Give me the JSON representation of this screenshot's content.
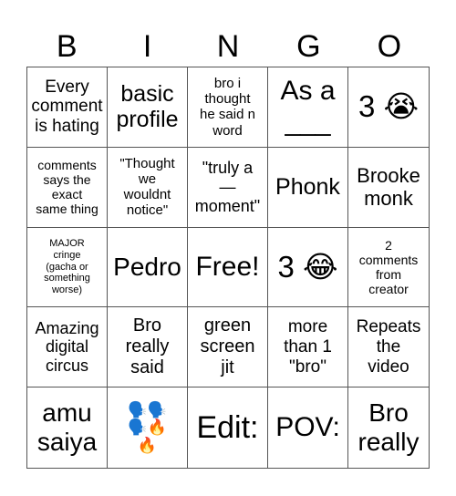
{
  "header": [
    "B",
    "I",
    "N",
    "G",
    "O"
  ],
  "cells": [
    {
      "text": "Every\ncomment\nis hating",
      "name": "every-comment-is-hating"
    },
    {
      "text": "basic\nprofile",
      "name": "basic-profile"
    },
    {
      "text": "bro i\nthought\nhe said n\nword",
      "name": "bro-i-thought-he-said-n-word"
    },
    {
      "text": "As a\n___",
      "name": "as-a-blank"
    },
    {
      "text": "3 😭",
      "name": "three-crying-emoji"
    },
    {
      "text": "comments\nsays the\nexact\nsame thing",
      "name": "comments-say-the-exact-same-thing"
    },
    {
      "text": "\"Thought\nwe\nwouldnt\nnotice\"",
      "name": "thought-we-wouldnt-notice"
    },
    {
      "text": "\"truly a\n—\nmoment\"",
      "name": "truly-a-moment"
    },
    {
      "text": "Phonk",
      "name": "phonk"
    },
    {
      "text": "Brooke\nmonk",
      "name": "brooke-monk"
    },
    {
      "text": "MAJOR\ncringe\n(gacha or\nsomething\nworse)",
      "name": "major-cringe"
    },
    {
      "text": "Pedro",
      "name": "pedro"
    },
    {
      "text": "Free!",
      "name": "free-space"
    },
    {
      "text": "3 😂",
      "name": "three-laughing-emoji"
    },
    {
      "text": "2\ncomments\nfrom\ncreator",
      "name": "two-comments-from-creator"
    },
    {
      "text": "Amazing\ndigital\ncircus",
      "name": "amazing-digital-circus"
    },
    {
      "text": "Bro\nreally\nsaid",
      "name": "bro-really-said"
    },
    {
      "text": "green\nscreen\njit",
      "name": "green-screen-jit"
    },
    {
      "text": "more\nthan 1\n\"bro\"",
      "name": "more-than-one-bro"
    },
    {
      "text": "Repeats\nthe\nvideo",
      "name": "repeats-the-video"
    },
    {
      "text": "amu\nsaiya",
      "name": "amu-saiya"
    },
    {
      "text": "🗣️🗣️\n🗣️🔥\n🔥",
      "name": "speaking-head-fire-emojis"
    },
    {
      "text": "Edit:",
      "name": "edit"
    },
    {
      "text": "POV:",
      "name": "pov"
    },
    {
      "text": "Bro\nreally",
      "name": "bro-really"
    }
  ]
}
